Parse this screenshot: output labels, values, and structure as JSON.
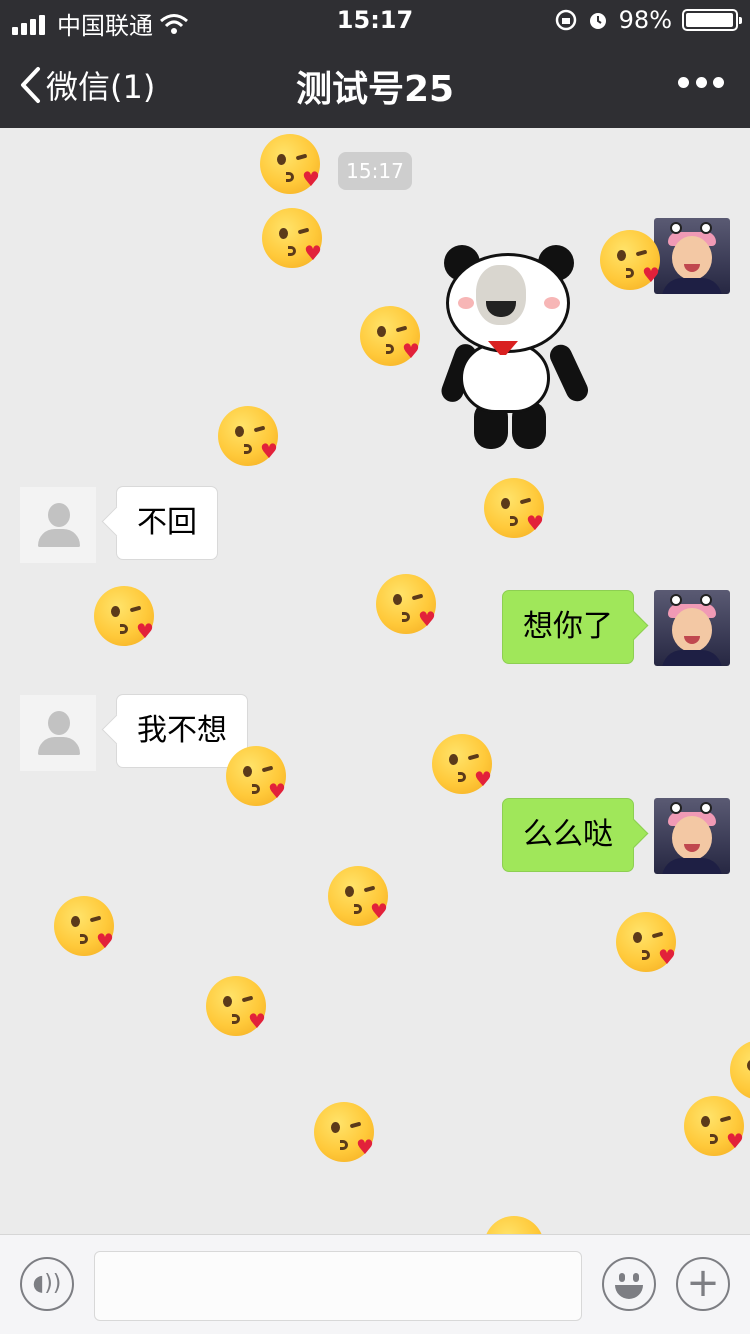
{
  "status_bar": {
    "carrier": "中国联通",
    "time": "15:17",
    "battery_percent": "98%",
    "battery_level": 0.98,
    "icons": [
      "signal-icon",
      "wifi-icon",
      "orientation-lock-icon",
      "alarm-icon",
      "battery-icon"
    ]
  },
  "nav": {
    "back_label": "微信(1)",
    "title": "测试号25",
    "more_icon": "more-icon"
  },
  "chat": {
    "timestamp": "15:17",
    "messages": [
      {
        "from": "me",
        "type": "sticker",
        "sticker": "panda-sticker"
      },
      {
        "from": "other",
        "type": "text",
        "text": "不回"
      },
      {
        "from": "me",
        "type": "text",
        "text": "想你了"
      },
      {
        "from": "other",
        "type": "text",
        "text": "我不想"
      },
      {
        "from": "me",
        "type": "text",
        "text": "么么哒"
      }
    ]
  },
  "effects": {
    "emoji": "kissing-face-with-heart-emoji"
  },
  "input_bar": {
    "voice_icon": "voice-icon",
    "input_value": "",
    "emoji_icon": "emoji-icon",
    "plus_icon": "plus-icon"
  },
  "colors": {
    "nav_background": "#2f2f33",
    "chat_background": "#ebebeb",
    "my_bubble": "#a0e75a",
    "other_bubble": "#ffffff"
  }
}
